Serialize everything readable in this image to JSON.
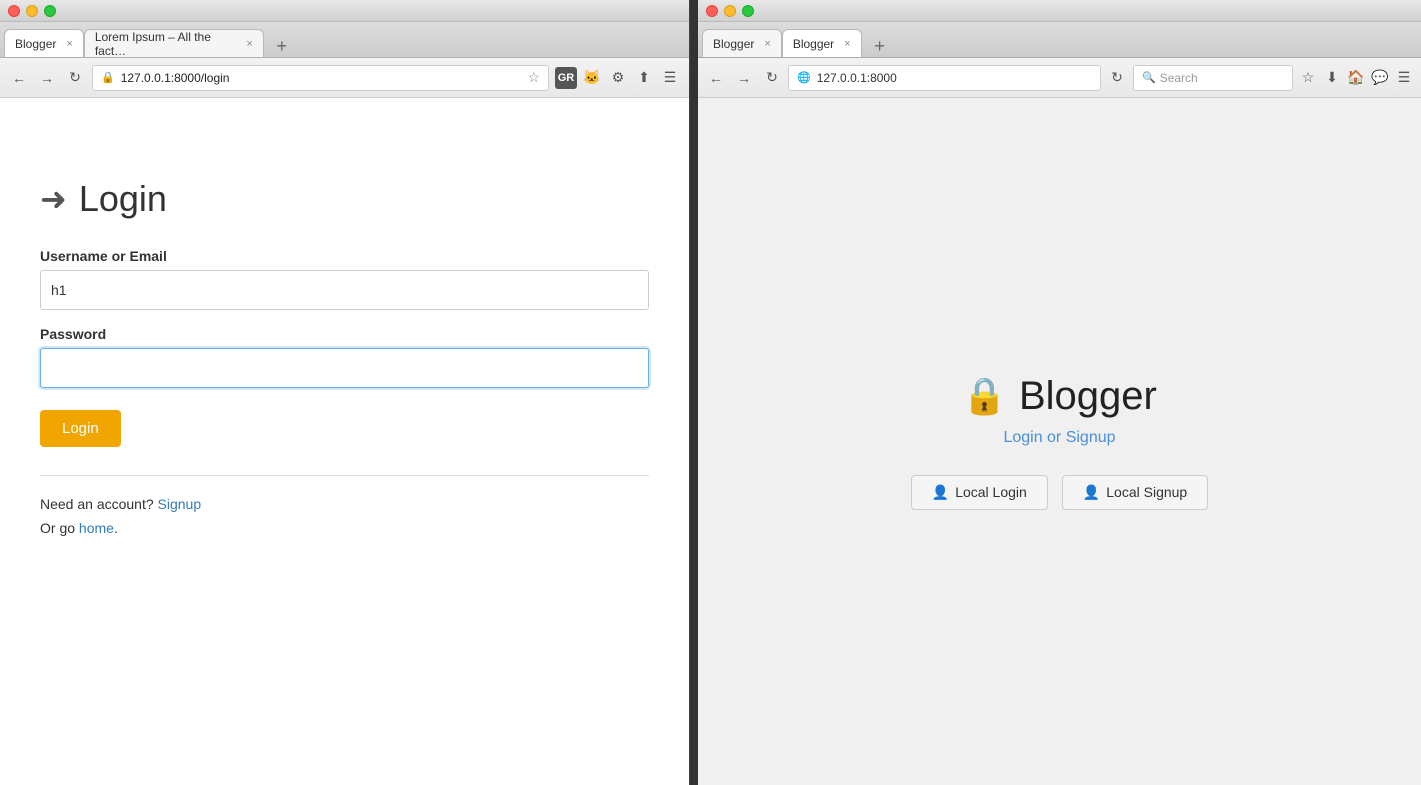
{
  "left_browser": {
    "title_bar": {
      "close_label": "×",
      "min_label": "−",
      "max_label": "+"
    },
    "tabs": [
      {
        "label": "Blogger",
        "active": true
      },
      {
        "label": "Lorem Ipsum – All the fact…",
        "active": false
      }
    ],
    "address_bar": {
      "url": "127.0.0.1:8000/login",
      "back_label": "←",
      "forward_label": "→",
      "reload_label": "↻"
    },
    "page": {
      "page_icon": "➜",
      "title": "Login",
      "username_label": "Username or Email",
      "username_value": "h1",
      "password_label": "Password",
      "password_value": "",
      "login_button": "Login",
      "need_account_text": "Need an account?",
      "signup_link": "Signup",
      "or_go_text": "Or go",
      "home_link": "home",
      "home_suffix": "."
    }
  },
  "right_browser": {
    "title_bar": {
      "close_label": "×",
      "min_label": "−",
      "max_label": "+"
    },
    "tabs": [
      {
        "label": "Blogger",
        "active": false
      },
      {
        "label": "Blogger",
        "active": true
      }
    ],
    "address_bar": {
      "url": "127.0.0.1:8000",
      "reload_label": "↻",
      "search_placeholder": "Search"
    },
    "page": {
      "lock_icon": "🔒",
      "title": "Blogger",
      "subtitle": "Login or Signup",
      "local_login_button": "Local Login",
      "local_signup_button": "Local Signup",
      "user_icon": "👤"
    }
  }
}
